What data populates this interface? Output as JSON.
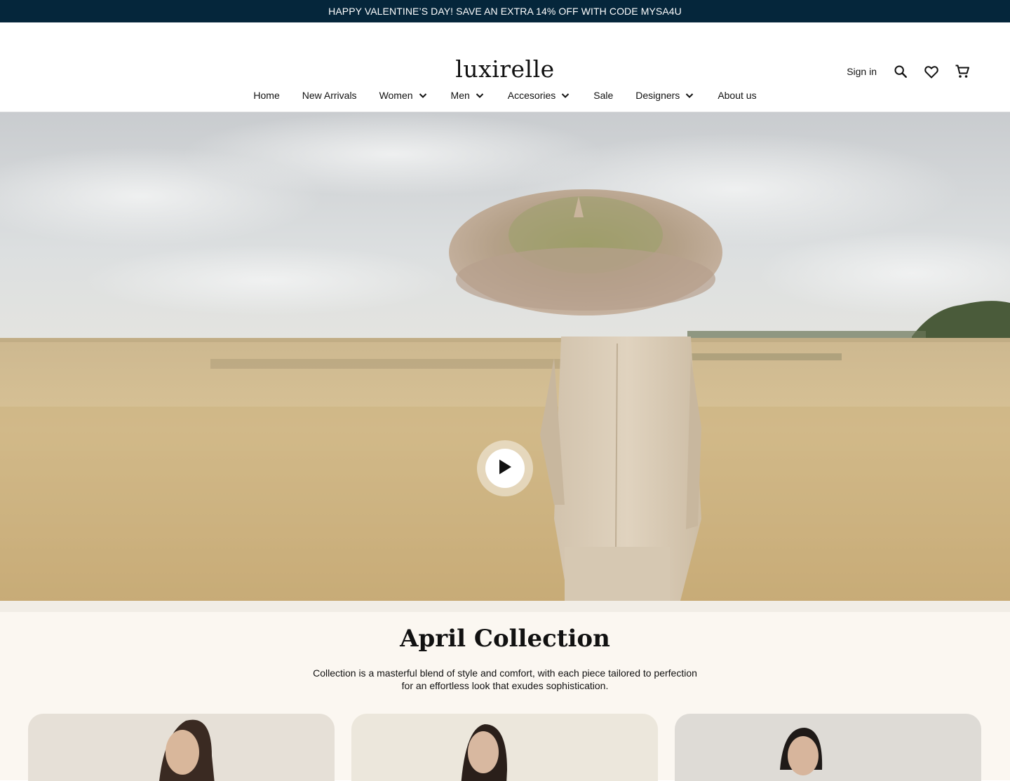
{
  "announcement": {
    "text": "HAPPY VALENTINE’S DAY! SAVE AN EXTRA 14% OFF WITH CODE MYSA4U"
  },
  "header": {
    "logo": "luxirelle",
    "signin_label": "Sign in"
  },
  "nav": {
    "items": [
      {
        "label": "Home",
        "has_dropdown": false
      },
      {
        "label": "New Arrivals",
        "has_dropdown": false
      },
      {
        "label": "Women",
        "has_dropdown": true
      },
      {
        "label": "Men",
        "has_dropdown": true
      },
      {
        "label": "Accesories",
        "has_dropdown": true
      },
      {
        "label": "Sale",
        "has_dropdown": false
      },
      {
        "label": "Designers",
        "has_dropdown": true
      },
      {
        "label": "About us",
        "has_dropdown": false
      }
    ]
  },
  "icons": [
    "search-icon",
    "heart-icon",
    "cart-icon",
    "chevron-down-icon",
    "play-icon"
  ],
  "collection": {
    "title": "April Collection",
    "description_line1": "Collection is a masterful blend of style and comfort, with each piece tailored to perfection",
    "description_line2": "for an effortless look that exudes sophistication."
  },
  "colors": {
    "announcement_bg": "#05263b",
    "section_bg": "#fbf7f1"
  }
}
